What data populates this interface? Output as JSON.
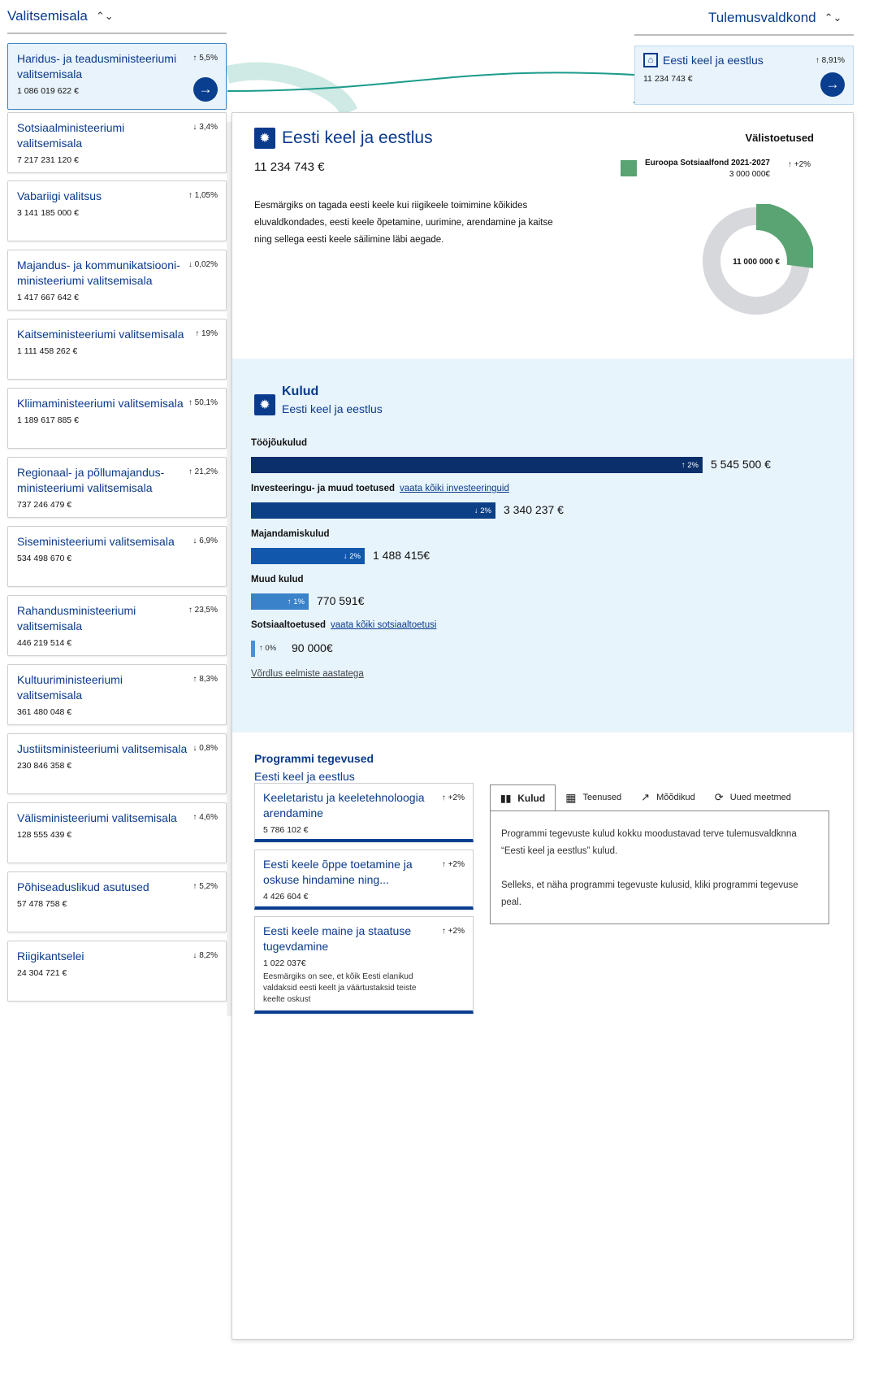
{
  "left_header": {
    "title": "Valitsemisala",
    "sort_icon": "sort-icon"
  },
  "right_header": {
    "title": "Tulemusvaldkond",
    "sort_icon": "sort-icon"
  },
  "ministries": [
    {
      "name": "Haridus- ja teadusministeeriumi valitsemisala",
      "amount": "1 086 019 622 €",
      "pct": "↑ 5,5%",
      "active": true
    },
    {
      "name": "Sotsiaalministeeriumi valitsemisala",
      "amount": "7 217 231 120 €",
      "pct": "↓ 3,4%"
    },
    {
      "name": "Vabariigi valitsus",
      "amount": "3 141 185 000 €",
      "pct": "↑ 1,05%"
    },
    {
      "name": "Majandus- ja kommunikatsiooni-ministeeriumi valitsemisala",
      "amount": "1 417 667 642 €",
      "pct": "↓ 0,02%"
    },
    {
      "name": "Kaitseministeeriumi valitsemisala",
      "amount": "1 111 458 262 €",
      "pct": "↑ 19%"
    },
    {
      "name": "Kliimaministeeriumi valitsemisala",
      "amount": "1 189 617 885 €",
      "pct": "↑ 50,1%"
    },
    {
      "name": "Regionaal- ja põllumajandus-ministeeriumi valitsemisala",
      "amount": "737 246 479 €",
      "pct": "↑ 21,2%"
    },
    {
      "name": "Siseministeeriumi valitsemisala",
      "amount": "534 498 670 €",
      "pct": "↓ 6,9%"
    },
    {
      "name": "Rahandusministeeriumi valitsemisala",
      "amount": "446 219 514 €",
      "pct": "↑ 23,5%"
    },
    {
      "name": "Kultuuriministeeriumi valitsemisala",
      "amount": "361 480 048 €",
      "pct": "↑ 8,3%"
    },
    {
      "name": "Justiitsministeeriumi valitsemisala",
      "amount": "230 846 358 €",
      "pct": "↓ 0,8%"
    },
    {
      "name": "Välisministeeriumi valitsemisala",
      "amount": "128 555 439 €",
      "pct": "↑ 4,6%"
    },
    {
      "name": "Põhiseaduslikud asutused",
      "amount": "57 478 758 €",
      "pct": "↑ 5,2%"
    },
    {
      "name": "Riigikantselei",
      "amount": "24 304 721 €",
      "pct": "↓ 8,2%"
    }
  ],
  "result_area": {
    "title": "Eesti keel ja eestlus",
    "amount": "11 234 743 €",
    "pct": "↑ 8,91%"
  },
  "detail": {
    "title": "Eesti keel ja eestlus",
    "amount": "11 234 743 €",
    "description": "Eesmärgiks on tagada eesti keele kui riigikeele toimimine kõikides eluvaldkondades, eesti keele õpetamine, uurimine, arendamine ja kaitse ning sellega eesti keele säilimine läbi aegade.",
    "external_title": "Välistoetused",
    "external_item": {
      "name": "Euroopa Sotsiaalfond 2021-2027",
      "amount": "3 000 000€",
      "pct": "↑ +2%",
      "color": "#5aa372"
    },
    "donut_label": "11 000 000 €",
    "donut_share": 0.27
  },
  "costs": {
    "title": "Kulud",
    "subtitle": "Eesti keel ja eestlus",
    "items": [
      {
        "label": "Tööjõukulud",
        "pct": "↑ 2%",
        "value": "5 545 500 €",
        "share": 1.0,
        "color": "#0b2f6b"
      },
      {
        "label": "Investeeringu- ja muud toetused",
        "link": "vaata kõiki investeeringuid",
        "pct": "↓ 2%",
        "value": "3 340 237 €",
        "share": 0.542,
        "color": "#0b3f86"
      },
      {
        "label": "Majandamiskulud",
        "pct": "↓ 2%",
        "value": "1 488 415€",
        "share": 0.252,
        "color": "#1158ad"
      },
      {
        "label": "Muud kulud",
        "pct": "↑ 1%",
        "value": "770 591€",
        "share": 0.127,
        "color": "#3a82c9"
      },
      {
        "label": "Sotsiaaltoetused",
        "link": "vaata kõiki sotsiaaltoetusi",
        "pct": "↑ 0%",
        "value": "90 000€",
        "share": 0.0,
        "color": "#4f8fd0"
      }
    ],
    "compare_link": "Võrdlus eelmiste aastatega"
  },
  "program": {
    "title": "Programmi tegevused",
    "subtitle": "Eesti keel ja eestlus",
    "items": [
      {
        "name": "Keeletaristu ja keeletehnoloogia arendamine",
        "amount": "5 786 102 €",
        "pct": "↑ +2%"
      },
      {
        "name": "Eesti keele õppe toetamine ja oskuse hindamine ning...",
        "amount": "4 426 604 €",
        "pct": "↑ +2%"
      },
      {
        "name": "Eesti keele maine ja staatuse tugevdamine",
        "amount": "1 022 037€",
        "pct": "↑ +2%",
        "desc": "Eesmärgiks on see, et kõik Eesti elanikud valdaksid eesti keelt ja väärtustaksid teiste keelte oskust"
      }
    ],
    "tabs": [
      {
        "label": "Kulud",
        "icon": "bar-chart-icon",
        "active": true
      },
      {
        "label": "Teenused",
        "icon": "grid-icon"
      },
      {
        "label": "Mõõdikud",
        "icon": "trend-icon"
      },
      {
        "label": "Uued meetmed",
        "icon": "refresh-icon"
      }
    ],
    "tab_text_1": "Programmi tegevuste kulud kokku moodustavad terve tulemusvaldknna “Eesti keel ja eestlus” kulud.",
    "tab_text_2": "Selleks, et näha programmi tegevuste kulusid, kliki programmi tegevuse peal."
  }
}
